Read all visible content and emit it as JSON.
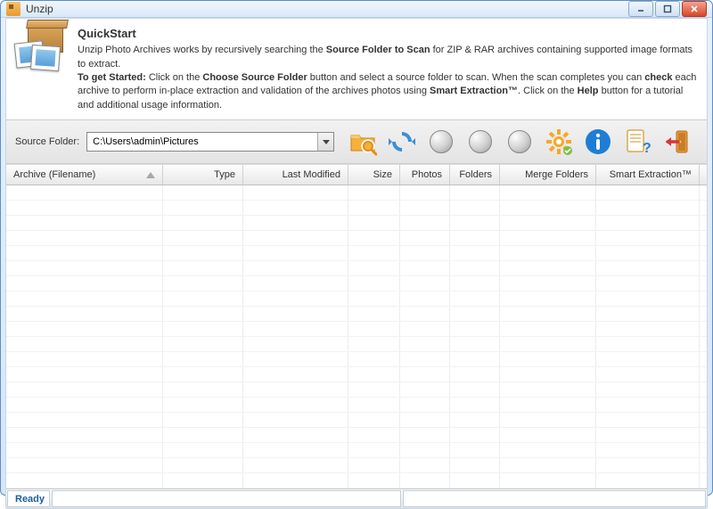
{
  "window": {
    "title": "Unzip"
  },
  "quickstart": {
    "title": "QuickStart",
    "line1_a": "Unzip Photo Archives works by recursively searching the ",
    "line1_b": "Source Folder to Scan",
    "line1_c": " for ZIP & RAR archives containing supported image formats to extract.",
    "line2_a": "To get Started:",
    "line2_b": "  Click on the ",
    "line2_c": "Choose Source Folder",
    "line2_d": " button and select a source folder to scan.  When the scan completes you can ",
    "line2_e": "check",
    "line2_f": " each archive to perform in-place extraction and validation of the archives photos using ",
    "line2_g": "Smart Extraction™",
    "line2_h": ".  Click on the ",
    "line2_i": "Help",
    "line2_j": " button for a tutorial and additional usage information."
  },
  "toolbar": {
    "source_label": "Source Folder:",
    "source_value": "C:\\Users\\admin\\Pictures"
  },
  "columns": {
    "archive": "Archive (Filename)",
    "type": "Type",
    "modified": "Last Modified",
    "size": "Size",
    "photos": "Photos",
    "folders": "Folders",
    "merge": "Merge Folders",
    "smart": "Smart Extraction™"
  },
  "status": {
    "ready": "Ready"
  }
}
